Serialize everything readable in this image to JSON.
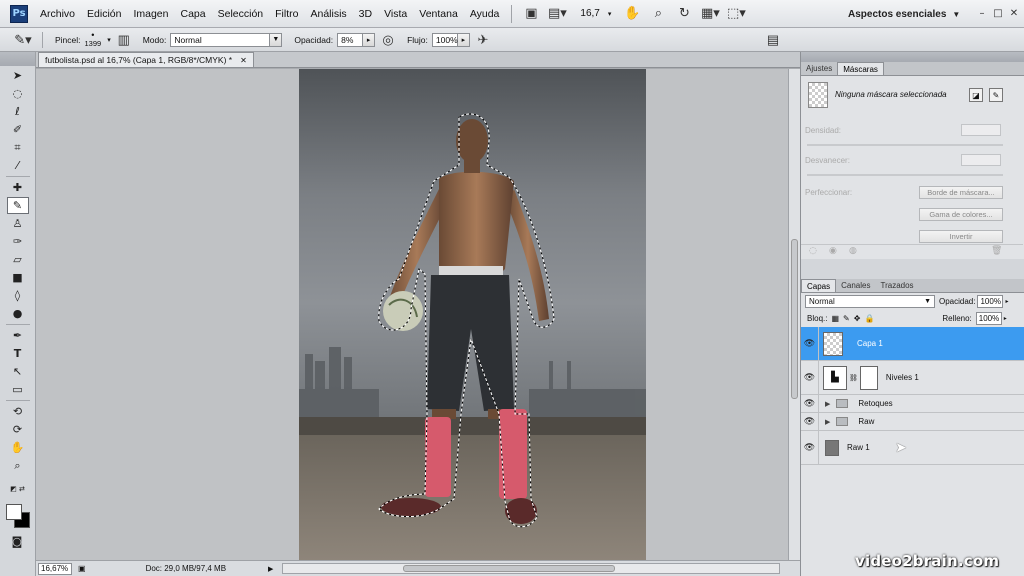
{
  "app": {
    "logo": "Ps"
  },
  "menu": [
    "Archivo",
    "Edición",
    "Imagen",
    "Capa",
    "Selección",
    "Filtro",
    "Análisis",
    "3D",
    "Vista",
    "Ventana",
    "Ayuda"
  ],
  "toolbar": {
    "zoom": "16,7"
  },
  "workspace": {
    "label": "Aspectos esenciales"
  },
  "options": {
    "brush_label": "Pincel:",
    "brush_size": "1399",
    "mode_label": "Modo:",
    "mode_value": "Normal",
    "opacity_label": "Opacidad:",
    "opacity_value": "8%",
    "flow_label": "Flujo:",
    "flow_value": "100%"
  },
  "document": {
    "tab_title": "futbolista.psd al 16,7% (Capa 1, RGB/8*/CMYK) *",
    "zoom": "16,67%",
    "doc_info": "Doc: 29,0 MB/97,4 MB"
  },
  "mask_panel": {
    "tabs": [
      "Ajustes",
      "Máscaras"
    ],
    "title": "Ninguna máscara seleccionada",
    "density_label": "Densidad:",
    "feather_label": "Desvanecer:",
    "refine_label": "Perfeccionar:",
    "btn_mask_edge": "Borde de máscara...",
    "btn_color_range": "Gama de colores...",
    "btn_invert": "Invertir"
  },
  "layers_panel": {
    "tabs": [
      "Capas",
      "Canales",
      "Trazados"
    ],
    "blend_mode": "Normal",
    "opacity_label": "Opacidad:",
    "opacity_value": "100%",
    "lock_label": "Bloq.:",
    "fill_label": "Relleno:",
    "fill_value": "100%",
    "layers": [
      {
        "name": "Capa 1"
      },
      {
        "name": "Niveles 1"
      },
      {
        "name": "Retoques"
      },
      {
        "name": "Raw"
      },
      {
        "name": "Raw 1"
      }
    ]
  },
  "watermark": "video2brain.com",
  "colors": {
    "selection": "#3c9bf0",
    "panel_bg": "#e1e3e6",
    "socks": "#d65a6c"
  }
}
